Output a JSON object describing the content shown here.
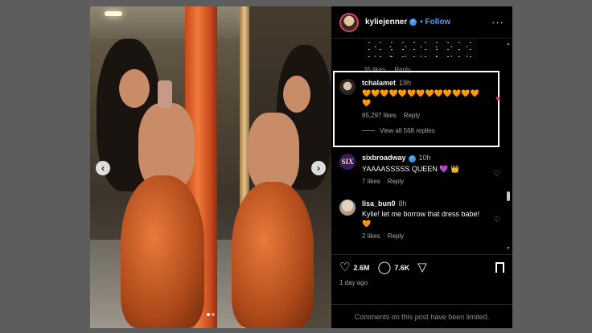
{
  "post": {
    "author": "kyliejenner",
    "follow_label": "Follow",
    "more_glyph": "···",
    "carousel": {
      "prev_glyph": "‹",
      "next_glyph": "›",
      "slide_count": 2,
      "active_slide": 1
    }
  },
  "comments": {
    "previous": {
      "likes": "35 likes",
      "reply": "Reply"
    },
    "items": [
      {
        "user": "tchalamet",
        "time": "19h",
        "text": "🧡🧡🧡🧡🧡🧡🧡🧡🧡🧡🧡🧡🧡🧡",
        "likes": "65,297 likes",
        "reply": "Reply",
        "liked": true,
        "view_replies": "View all 568 replies"
      },
      {
        "user": "sixbroadway",
        "verified": true,
        "time": "10h",
        "text": "YAAAASSSSS QUEEN 💜 👑",
        "likes": "7 likes",
        "reply": "Reply",
        "avatar_text": "SIX"
      },
      {
        "user": "lisa_bun0",
        "time": "8h",
        "text": "Kylie! let me borrow that dress babe! 🧡",
        "likes": "2 likes",
        "reply": "Reply"
      }
    ]
  },
  "actions": {
    "like_count": "2.6M",
    "comment_count": "7.6K",
    "posted_ago": "1 day ago"
  },
  "footer": {
    "limited_text": "Comments on this post have been limited."
  },
  "colors": {
    "accent": "#4a9df8",
    "liked_heart": "#ed2f4b",
    "highlight_border": "#ffffff"
  }
}
